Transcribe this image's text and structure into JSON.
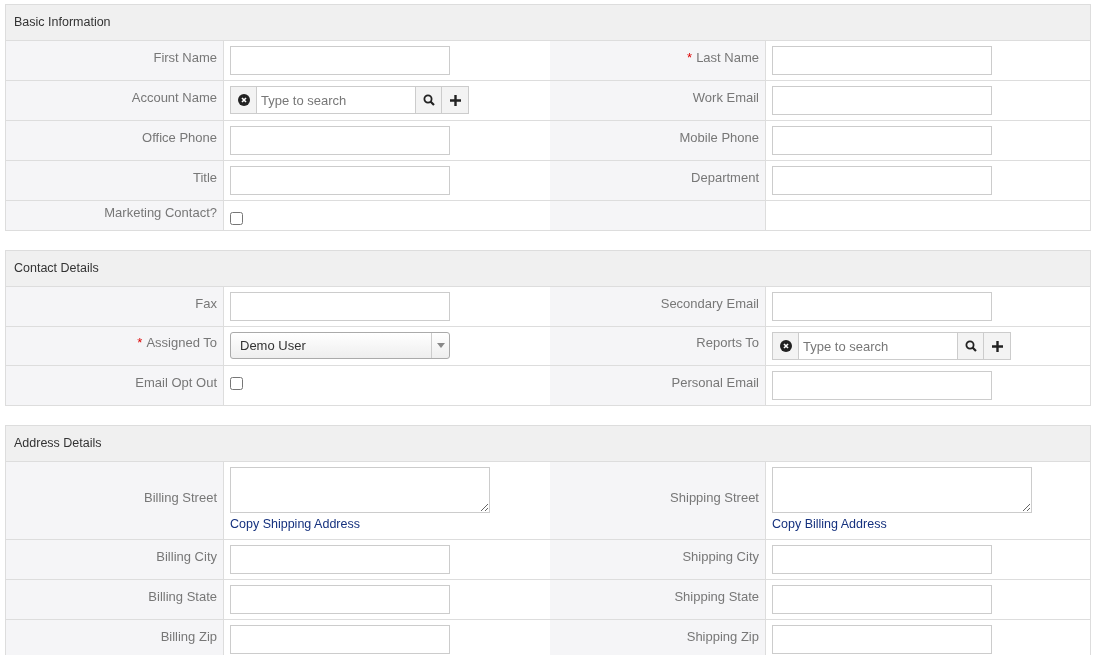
{
  "sections": [
    {
      "title": "Basic Information",
      "rows": [
        [
          {
            "kind": "text",
            "label": "First Name"
          },
          {
            "kind": "text",
            "label": "Last Name",
            "required_mark": "*"
          }
        ],
        [
          {
            "kind": "lookup",
            "label": "Account Name",
            "placeholder": "Type to search"
          },
          {
            "kind": "text",
            "label": "Work Email"
          }
        ],
        [
          {
            "kind": "text",
            "label": "Office Phone"
          },
          {
            "kind": "text",
            "label": "Mobile Phone"
          }
        ],
        [
          {
            "kind": "text",
            "label": "Title"
          },
          {
            "kind": "text",
            "label": "Department"
          }
        ],
        [
          {
            "kind": "checkbox",
            "label": "Marketing Contact?",
            "checked": false
          },
          {
            "kind": "empty"
          }
        ]
      ]
    },
    {
      "title": "Contact Details",
      "rows": [
        [
          {
            "kind": "text",
            "label": "Fax"
          },
          {
            "kind": "text",
            "label": "Secondary Email"
          }
        ],
        [
          {
            "kind": "select",
            "label": "Assigned To",
            "required_mark": "*",
            "value": "Demo User"
          },
          {
            "kind": "lookup",
            "label": "Reports To",
            "placeholder": "Type to search"
          }
        ],
        [
          {
            "kind": "checkbox",
            "label": "Email Opt Out",
            "checked": false
          },
          {
            "kind": "text",
            "label": "Personal Email"
          }
        ]
      ]
    },
    {
      "title": "Address Details",
      "rows": [
        [
          {
            "kind": "textarea",
            "label": "Billing Street",
            "link": "Copy Shipping Address"
          },
          {
            "kind": "textarea",
            "label": "Shipping Street",
            "link": "Copy Billing Address"
          }
        ],
        [
          {
            "kind": "text",
            "label": "Billing City"
          },
          {
            "kind": "text",
            "label": "Shipping City"
          }
        ],
        [
          {
            "kind": "text",
            "label": "Billing State"
          },
          {
            "kind": "text",
            "label": "Shipping State"
          }
        ],
        [
          {
            "kind": "text",
            "label": "Billing Zip"
          },
          {
            "kind": "text",
            "label": "Shipping Zip"
          }
        ]
      ]
    }
  ]
}
